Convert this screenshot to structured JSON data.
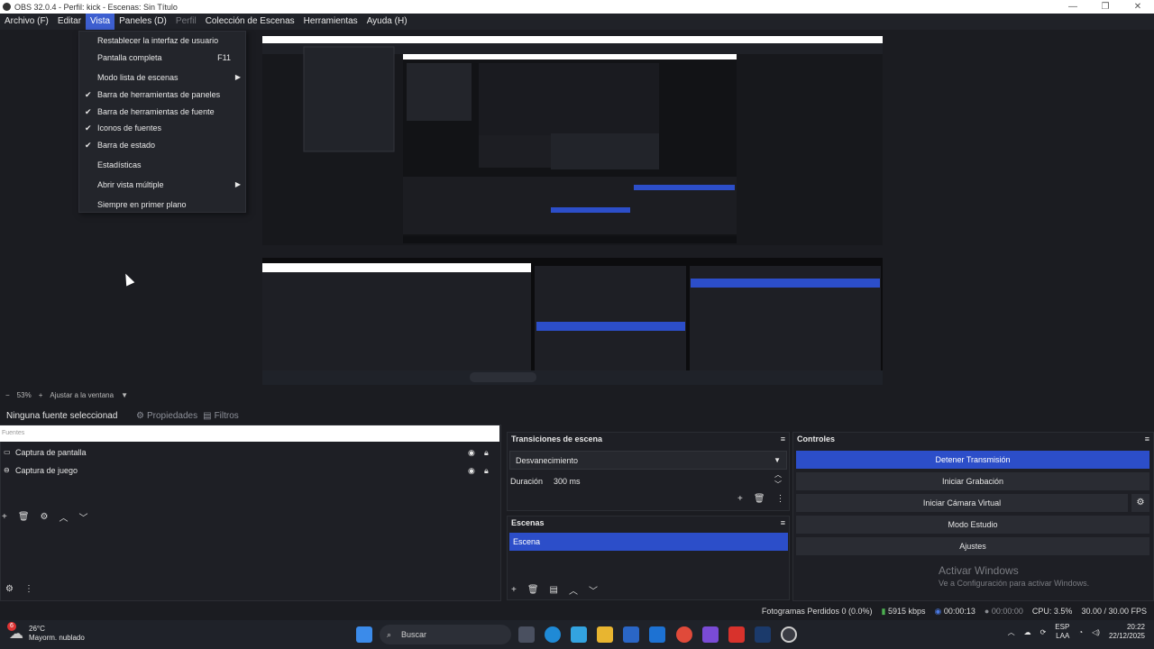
{
  "window": {
    "title": "OBS 32.0.4 - Perfil: kick - Escenas: Sin Título",
    "controls": [
      "—",
      "❐",
      "✕"
    ]
  },
  "menubar": {
    "items": [
      {
        "label": "Archivo (F)",
        "state": "normal"
      },
      {
        "label": "Editar",
        "state": "normal"
      },
      {
        "label": "Vista",
        "state": "active"
      },
      {
        "label": "Paneles (D)",
        "state": "normal"
      },
      {
        "label": "Perfil",
        "state": "disabled"
      },
      {
        "label": "Colección de Escenas",
        "state": "normal"
      },
      {
        "label": "Herramientas",
        "state": "normal"
      },
      {
        "label": "Ayuda (H)",
        "state": "normal"
      }
    ]
  },
  "vista_menu": {
    "items": [
      {
        "label": "Restablecer la interfaz de usuario",
        "checked": false,
        "shortcut": "",
        "submenu": false
      },
      {
        "label": "Pantalla completa",
        "checked": false,
        "shortcut": "F11",
        "submenu": false
      },
      {
        "label": "Modo lista de escenas",
        "checked": false,
        "shortcut": "",
        "submenu": true
      },
      {
        "label": "Barra de herramientas de paneles",
        "checked": true,
        "shortcut": "",
        "submenu": false
      },
      {
        "label": "Barra de herramientas de fuente",
        "checked": true,
        "shortcut": "",
        "submenu": false
      },
      {
        "label": "Iconos de fuentes",
        "checked": true,
        "shortcut": "",
        "submenu": false
      },
      {
        "label": "Barra de estado",
        "checked": true,
        "shortcut": "",
        "submenu": false
      },
      {
        "label": "Estadísticas",
        "checked": false,
        "shortcut": "",
        "submenu": false
      },
      {
        "label": "Abrir vista múltiple",
        "checked": false,
        "shortcut": "",
        "submenu": true
      },
      {
        "label": "Siempre en primer plano",
        "checked": false,
        "shortcut": "",
        "submenu": false
      }
    ]
  },
  "zoom": {
    "minus": "−",
    "value": "53%",
    "plus": "+",
    "fit": "Ajustar a la ventana"
  },
  "source_toolbar": {
    "no_selection": "Ninguna fuente seleccionad",
    "properties": "Propiedades",
    "filters": "Filtros"
  },
  "sources": {
    "header": "Fuentes",
    "items": [
      {
        "name": "Captura de pantalla",
        "icon": "monitor-icon"
      },
      {
        "name": "Captura de juego",
        "icon": "gamepad-icon"
      }
    ]
  },
  "transitions": {
    "title": "Transiciones de escena",
    "selected": "Desvanecimiento",
    "duration_label": "Duración",
    "duration_value": "300 ms"
  },
  "scenes": {
    "title": "Escenas",
    "items": [
      "Escena"
    ]
  },
  "controls": {
    "title": "Controles",
    "buttons": [
      "Detener Transmisión",
      "Iniciar Grabación",
      "Iniciar Cámara Virtual",
      "Modo Estudio",
      "Ajustes"
    ]
  },
  "watermark": {
    "line1": "Activar Windows",
    "line2": "Ve a Configuración para activar Windows."
  },
  "status": {
    "dropped": "Fotogramas Perdidos 0 (0.0%)",
    "bitrate": "5915 kbps",
    "stream_time": "00:00:13",
    "rec_time": "00:00:00",
    "cpu": "CPU: 3.5%",
    "fps": "30.00 / 30.00 FPS"
  },
  "taskbar": {
    "weather_temp": "26°C",
    "weather_desc": "Mayorm. nublado",
    "weather_badge": "6",
    "search_placeholder": "Buscar",
    "lang1": "ESP",
    "lang2": "LAA",
    "time": "20:22",
    "date": "22/12/2025"
  },
  "colors": {
    "accent": "#2c4ec9",
    "menu_active": "#3d5fd0",
    "bg": "#1b1c21"
  }
}
